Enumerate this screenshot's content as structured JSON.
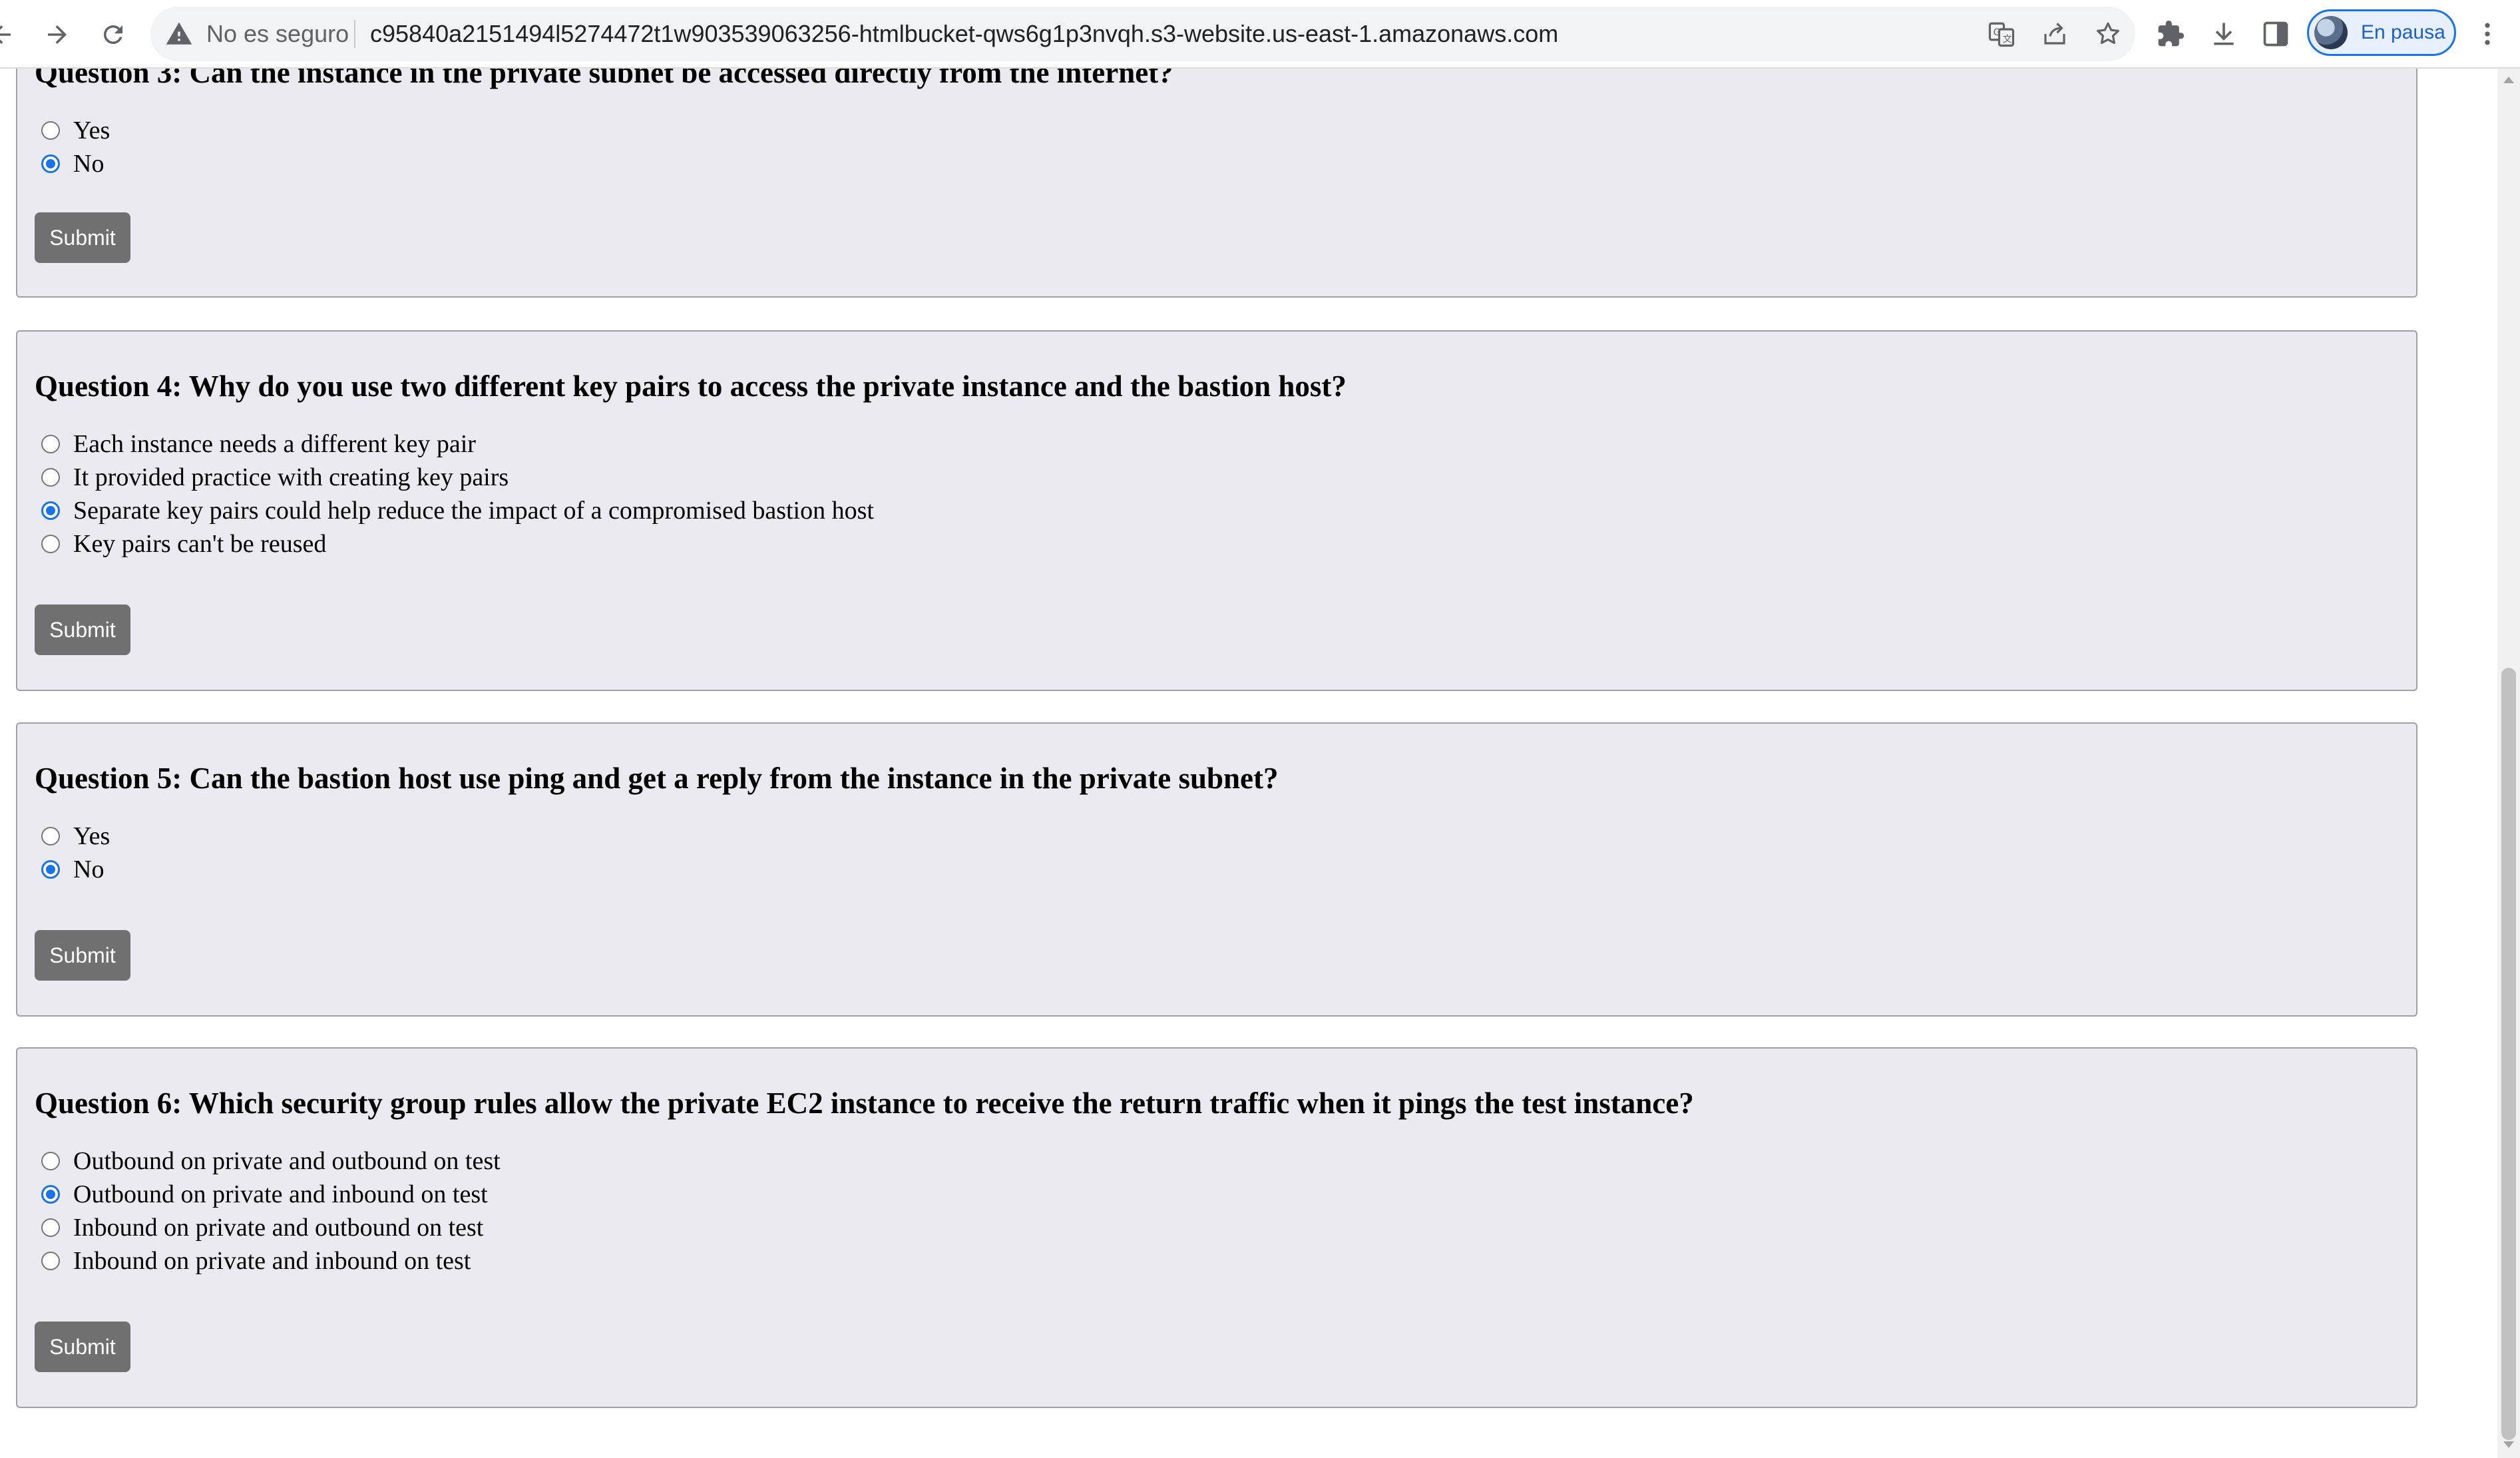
{
  "browser": {
    "security_label": "No es seguro",
    "url": "c95840a2151494l5274472t1w903539063256-htmlbucket-qws6g1p3nvqh.s3-website.us-east-1.amazonaws.com",
    "profile_label": "En pausa",
    "icons": [
      "back-icon",
      "forward-icon",
      "reload-icon",
      "warning-icon",
      "translate-icon",
      "share-icon",
      "star-icon",
      "extensions-icon",
      "download-icon",
      "side-panel-icon",
      "menu-icon"
    ]
  },
  "questions": [
    {
      "title": "Question 3: Can the instance in the private subnet be accessed directly from the internet?",
      "options": [
        {
          "label": "Yes",
          "checked": false
        },
        {
          "label": "No",
          "checked": true
        }
      ],
      "submit_label": "Submit"
    },
    {
      "title": "Question 4: Why do you use two different key pairs to access the private instance and the bastion host?",
      "options": [
        {
          "label": "Each instance needs a different key pair",
          "checked": false
        },
        {
          "label": "It provided practice with creating key pairs",
          "checked": false
        },
        {
          "label": "Separate key pairs could help reduce the impact of a compromised bastion host",
          "checked": true
        },
        {
          "label": "Key pairs can't be reused",
          "checked": false
        }
      ],
      "submit_label": "Submit"
    },
    {
      "title": "Question 5: Can the bastion host use ping and get a reply from the instance in the private subnet?",
      "options": [
        {
          "label": "Yes",
          "checked": false
        },
        {
          "label": "No",
          "checked": true
        }
      ],
      "submit_label": "Submit"
    },
    {
      "title": "Question 6: Which security group rules allow the private EC2 instance to receive the return traffic when it pings the test instance?",
      "options": [
        {
          "label": "Outbound on private and outbound on test",
          "checked": false
        },
        {
          "label": "Outbound on private and inbound on test",
          "checked": true
        },
        {
          "label": "Inbound on private and outbound on test",
          "checked": false
        },
        {
          "label": "Inbound on private and inbound on test",
          "checked": false
        }
      ],
      "submit_label": "Submit"
    }
  ],
  "colors": {
    "card_background": "#eaeaf0",
    "radio_checked": "#1a73e8",
    "submit_button": "#707070"
  }
}
